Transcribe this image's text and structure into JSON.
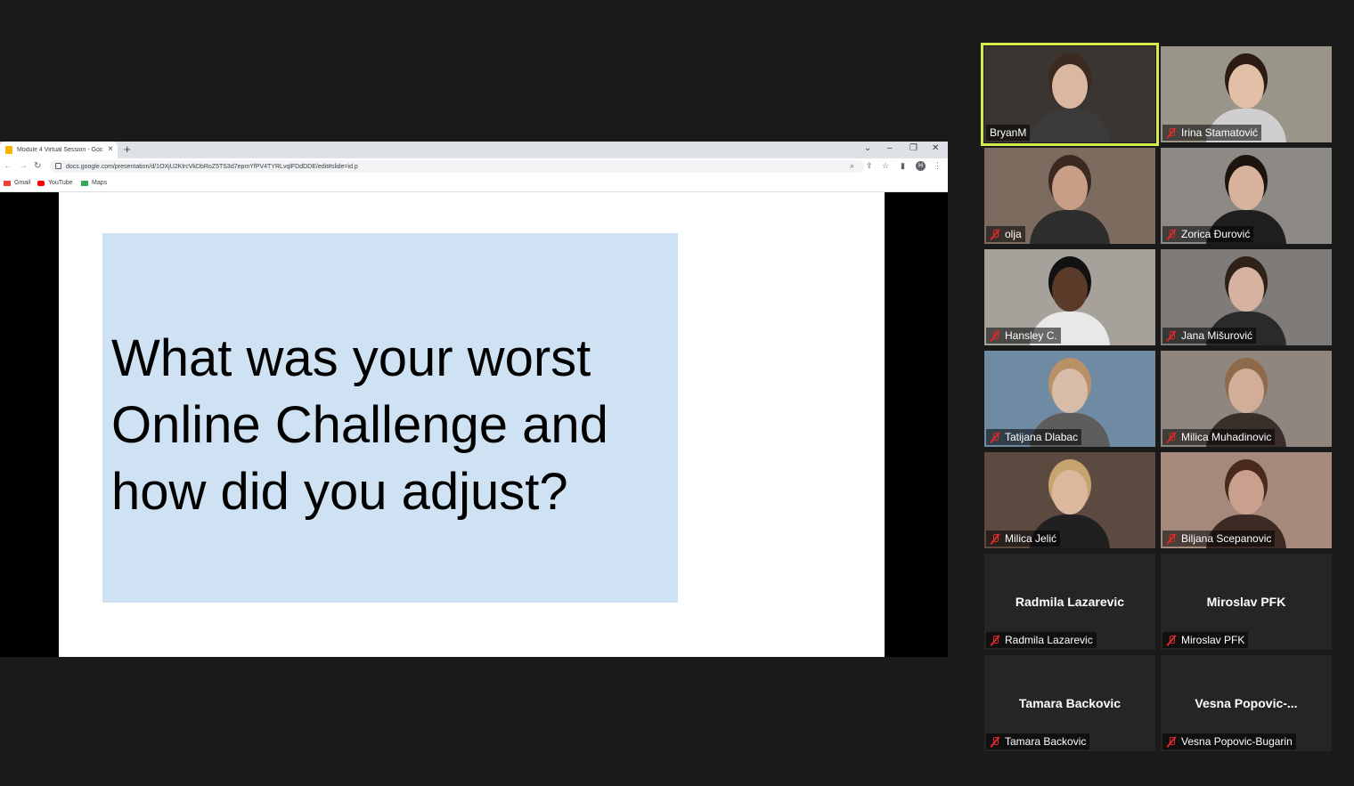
{
  "browser": {
    "tab_title": "Module 4 Virtual Session - Goog",
    "new_tab": "+",
    "url": "docs.google.com/presentation/d/1OXjU2KlrcVkDbRoZ5TS3d7epmYfPV4TYRLvqlFDdDDE/edit#slide=id.p",
    "profile_initial": "H",
    "bookmarks": [
      "Gmail",
      "YouTube",
      "Maps"
    ]
  },
  "slide": {
    "question": "What was your worst Online Challenge and how did you adjust?"
  },
  "colors": {
    "active_speaker_outline": "#d7ec4a",
    "slide_box": "#cfe2f3",
    "mute_icon": "#e02828"
  },
  "participants": [
    {
      "name": "BryanM",
      "muted": false,
      "video": true,
      "active": true
    },
    {
      "name": "Irina Stamatović",
      "muted": true,
      "video": true
    },
    {
      "name": "olja",
      "muted": true,
      "video": true
    },
    {
      "name": "Zorica Đurović",
      "muted": true,
      "video": true
    },
    {
      "name": "Hansley C.",
      "muted": true,
      "video": true
    },
    {
      "name": "Jana Mišurović",
      "muted": true,
      "video": true
    },
    {
      "name": "Tatijana Dlabac",
      "muted": true,
      "video": true
    },
    {
      "name": "Milica Muhadinovic",
      "muted": true,
      "video": true
    },
    {
      "name": "Milica Jelić",
      "muted": true,
      "video": true
    },
    {
      "name": "Biljana Scepanovic",
      "muted": true,
      "video": true
    },
    {
      "name": "Radmila Lazarevic",
      "display": "Radmila Lazarevic",
      "muted": true,
      "video": false
    },
    {
      "name": "Miroslav PFK",
      "display": "Miroslav PFK",
      "muted": true,
      "video": false
    },
    {
      "name": "Tamara Backovic",
      "display": "Tamara Backovic",
      "muted": true,
      "video": false
    },
    {
      "name": "Vesna Popovic-Bugarin",
      "display": "Vesna  Popovic-...",
      "muted": true,
      "video": false
    }
  ]
}
